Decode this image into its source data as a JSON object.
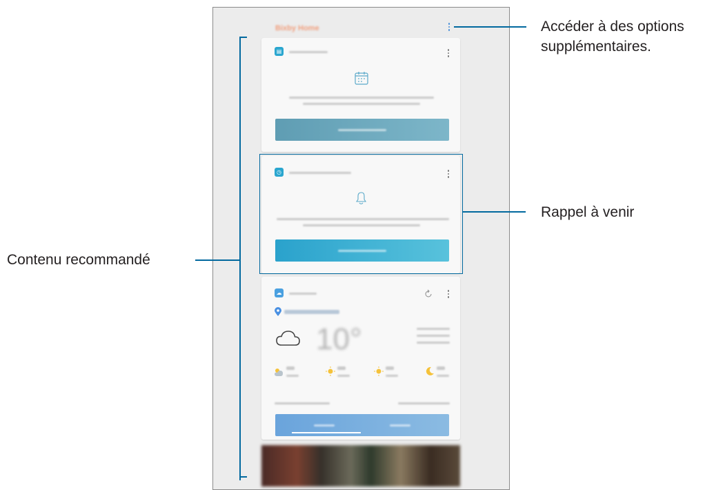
{
  "callouts": {
    "options_line1": "Accéder à des options",
    "options_line2": "supplémentaires.",
    "reminder": "Rappel à venir",
    "recommended": "Contenu recommandé"
  },
  "colors": {
    "callout_line": "#00689e",
    "accent_blue": "#2aa6cf",
    "schedule_button": "#6aa6bd",
    "reminder_button": "#3ab0d2",
    "weather_button": "#7ab0d8"
  },
  "icons": {
    "more": "more-vertical-icon",
    "calendar": "calendar-icon",
    "bell": "bell-icon",
    "refresh": "refresh-icon",
    "location": "location-pin-icon",
    "cloud": "cloud-icon",
    "sun": "sun-icon",
    "moon": "moon-icon"
  }
}
